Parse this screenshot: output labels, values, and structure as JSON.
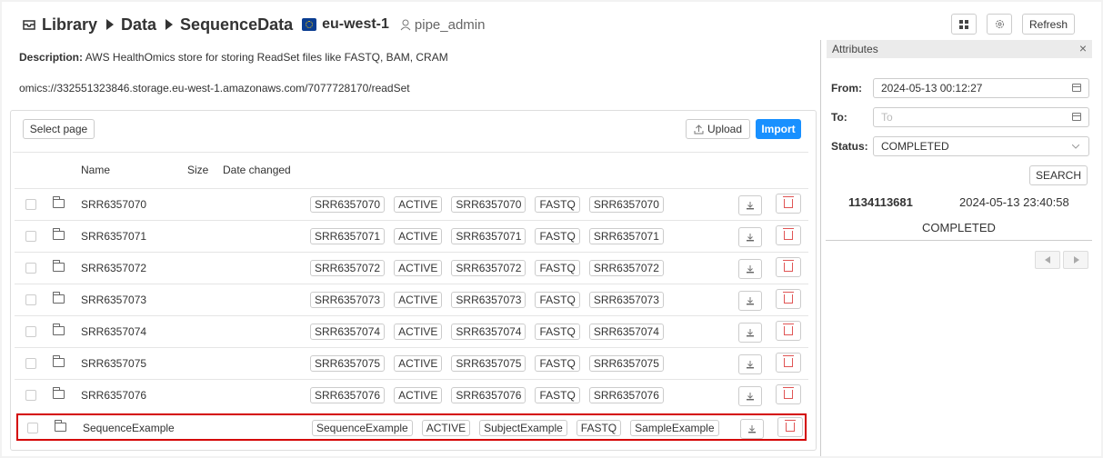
{
  "breadcrumb": [
    "Library",
    "Data",
    "SequenceData"
  ],
  "region": "eu-west-1",
  "owner": "pipe_admin",
  "toolbar": {
    "refresh_label": "Refresh"
  },
  "description": {
    "label": "Description:",
    "text": "AWS HealthOmics store for storing ReadSet files like FASTQ, BAM, CRAM"
  },
  "storage_path": "omics://332551323846.storage.eu-west-1.amazonaws.com/7077728170/readSet",
  "actions": {
    "select_page": "Select page",
    "upload": "Upload",
    "import": "Import"
  },
  "columns": [
    "Name",
    "Size",
    "Date changed"
  ],
  "rows": [
    {
      "name": "SRR6357070",
      "tags": [
        "SRR6357070",
        "ACTIVE",
        "SRR6357070",
        "FASTQ",
        "SRR6357070"
      ]
    },
    {
      "name": "SRR6357071",
      "tags": [
        "SRR6357071",
        "ACTIVE",
        "SRR6357071",
        "FASTQ",
        "SRR6357071"
      ]
    },
    {
      "name": "SRR6357072",
      "tags": [
        "SRR6357072",
        "ACTIVE",
        "SRR6357072",
        "FASTQ",
        "SRR6357072"
      ]
    },
    {
      "name": "SRR6357073",
      "tags": [
        "SRR6357073",
        "ACTIVE",
        "SRR6357073",
        "FASTQ",
        "SRR6357073"
      ]
    },
    {
      "name": "SRR6357074",
      "tags": [
        "SRR6357074",
        "ACTIVE",
        "SRR6357074",
        "FASTQ",
        "SRR6357074"
      ]
    },
    {
      "name": "SRR6357075",
      "tags": [
        "SRR6357075",
        "ACTIVE",
        "SRR6357075",
        "FASTQ",
        "SRR6357075"
      ]
    },
    {
      "name": "SRR6357076",
      "tags": [
        "SRR6357076",
        "ACTIVE",
        "SRR6357076",
        "FASTQ",
        "SRR6357076"
      ]
    },
    {
      "name": "SequenceExample",
      "tags": [
        "SequenceExample",
        "ACTIVE",
        "SubjectExample",
        "FASTQ",
        "SampleExample"
      ],
      "highlighted": true
    }
  ],
  "attributes": {
    "title": "Attributes",
    "from_label": "From:",
    "from_value": "2024-05-13 00:12:27",
    "to_label": "To:",
    "to_placeholder": "To",
    "status_label": "Status:",
    "status_value": "COMPLETED",
    "search_label": "SEARCH",
    "result": {
      "id": "1134113681",
      "date": "2024-05-13 23:40:58",
      "status": "COMPLETED"
    }
  },
  "colors": {
    "accent": "#1890ff",
    "highlight_border": "#d40000",
    "delete": "#e05555"
  }
}
